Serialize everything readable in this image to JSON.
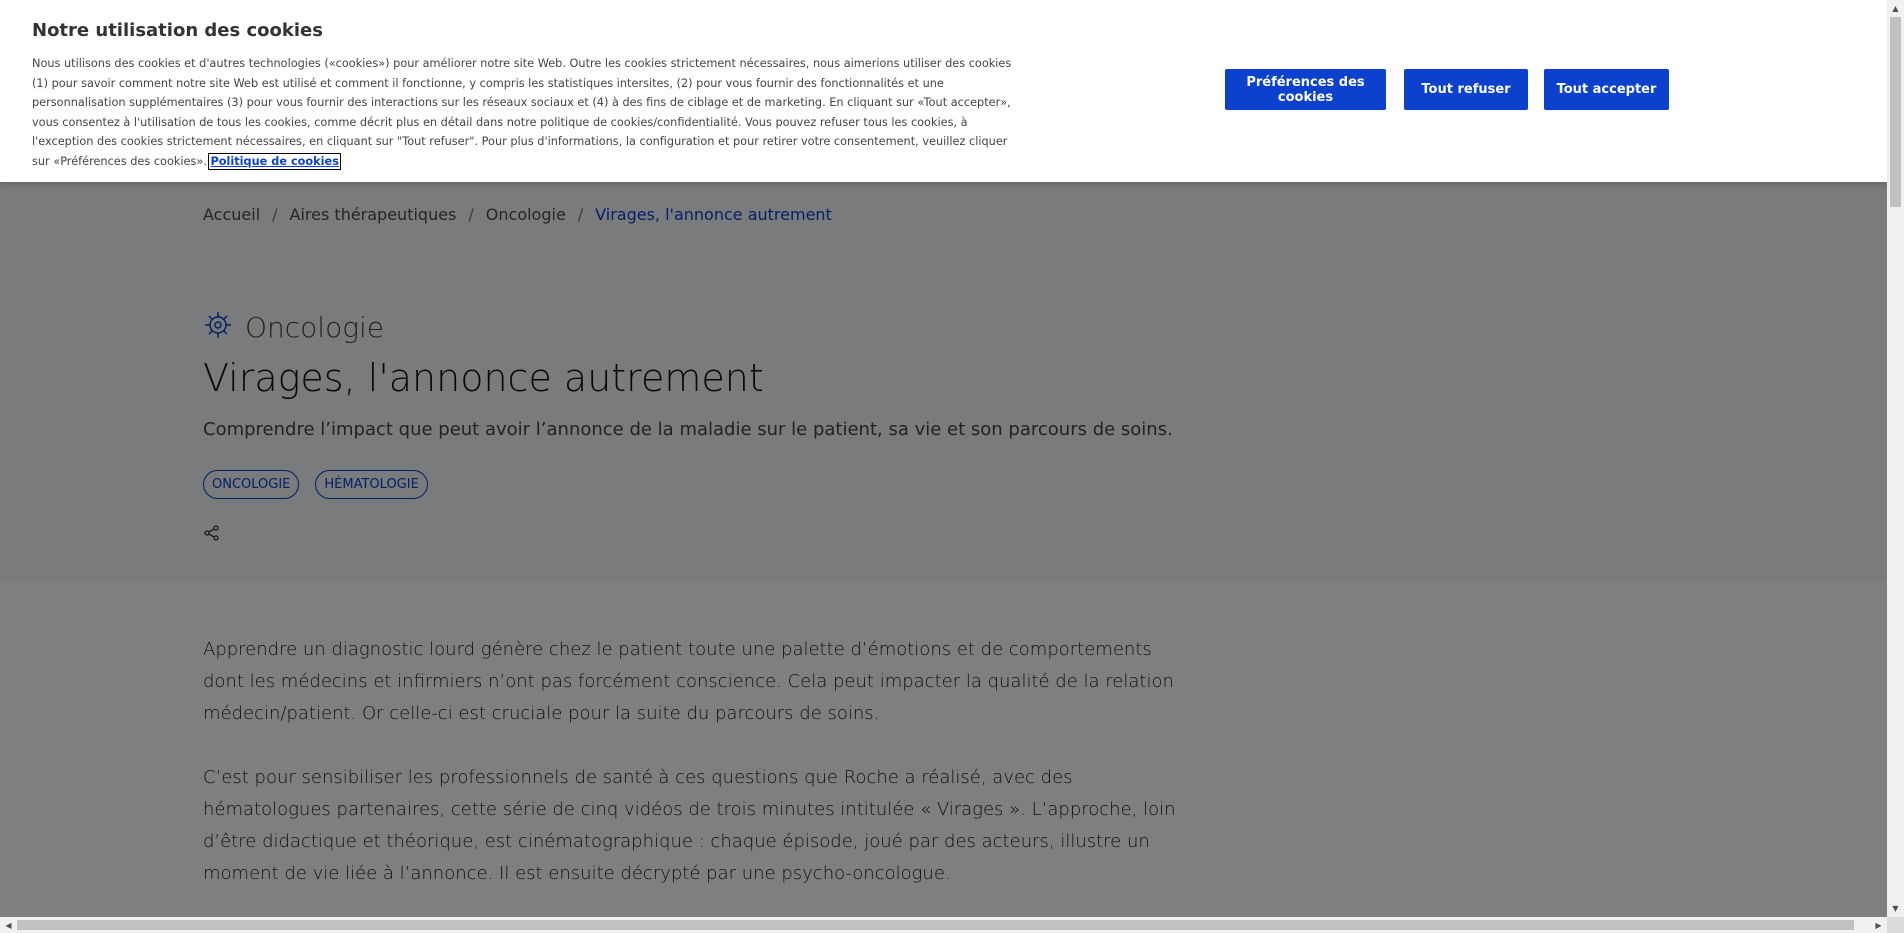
{
  "breadcrumb": {
    "items": [
      "Accueil",
      "Aires thérapeutiques",
      "Oncologie",
      "Virages, l'annonce autrement"
    ],
    "separator": "/"
  },
  "article": {
    "area_label": "Oncologie",
    "area_icon": "oncology-cell-icon",
    "title": "Virages, l'annonce autrement",
    "subtitle": "Comprendre l’impact que peut avoir l’annonce de la maladie sur le patient, sa vie et son parcours de soins.",
    "tags": [
      "ONCOLOGIE",
      "HÉMATOLOGIE"
    ],
    "share_icon": "share-icon",
    "paragraphs": [
      "Apprendre un diagnostic lourd génère chez le patient toute une palette d’émotions et de comportements dont les médecins et infirmiers n’ont pas forcément conscience. Cela peut impacter la qualité de la relation médecin/patient. Or celle-ci est cruciale pour la suite du parcours de soins.",
      "C’est pour sensibiliser les professionnels de santé à ces questions que Roche a réalisé, avec des hématologues partenaires, cette série de cinq vidéos de trois minutes intitulée « Virages ». L’approche, loin d’être didactique et théorique, est cinématographique : chaque épisode, joué par des acteurs, illustre un moment de vie liée à l’annonce. Il est ensuite décrypté par une psycho-oncologue."
    ]
  },
  "cookie_banner": {
    "title": "Notre utilisation des cookies",
    "description": "Nous utilisons des cookies et d'autres technologies («cookies») pour améliorer notre site Web. Outre les cookies strictement nécessaires, nous aimerions utiliser des cookies (1) pour savoir comment notre site Web est utilisé et comment il fonctionne, y compris les statistiques intersites, (2) pour vous fournir des fonctionnalités et une personnalisation supplémentaires (3) pour vous fournir des interactions sur les réseaux sociaux et (4) à des fins de ciblage et de marketing. En cliquant sur «Tout accepter», vous consentez à l'utilisation de tous les cookies, comme décrit plus en détail dans notre politique de cookies/confidentialité. Vous pouvez refuser tous les cookies, à l'exception des cookies strictement nécessaires, en cliquant sur \"Tout refuser\". Pour plus d'informations, la configuration et pour retirer votre consentement, veuillez cliquer sur «Préférences des cookies».",
    "policy_link": "Politique de cookies",
    "buttons": {
      "preferences": "Préférences des cookies",
      "refuse_all": "Tout refuser",
      "accept_all": "Tout accepter"
    },
    "accent_color": "#0b41cd"
  },
  "scrollbars": {
    "up_arrow": "▲",
    "down_arrow": "▼",
    "left_arrow": "◀",
    "right_arrow": "▶"
  }
}
